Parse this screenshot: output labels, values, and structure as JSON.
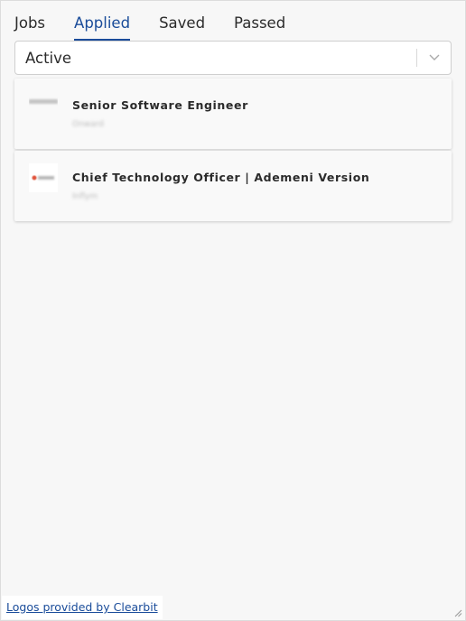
{
  "tabs": [
    {
      "label": "Jobs",
      "active": false
    },
    {
      "label": "Applied",
      "active": true
    },
    {
      "label": "Saved",
      "active": false
    },
    {
      "label": "Passed",
      "active": false
    }
  ],
  "filter": {
    "selected": "Active",
    "icon": "chevron-down-icon"
  },
  "jobs": [
    {
      "title": "Senior Software Engineer",
      "company": "Onward"
    },
    {
      "title": "Chief Technology Officer | Ademeni Version",
      "company": "Inflym"
    }
  ],
  "footer": {
    "link_text": "Logos provided by Clearbit"
  },
  "colors": {
    "accent": "#1a4c9a",
    "background": "#f7f7f7",
    "card": "#f9f9f9"
  }
}
